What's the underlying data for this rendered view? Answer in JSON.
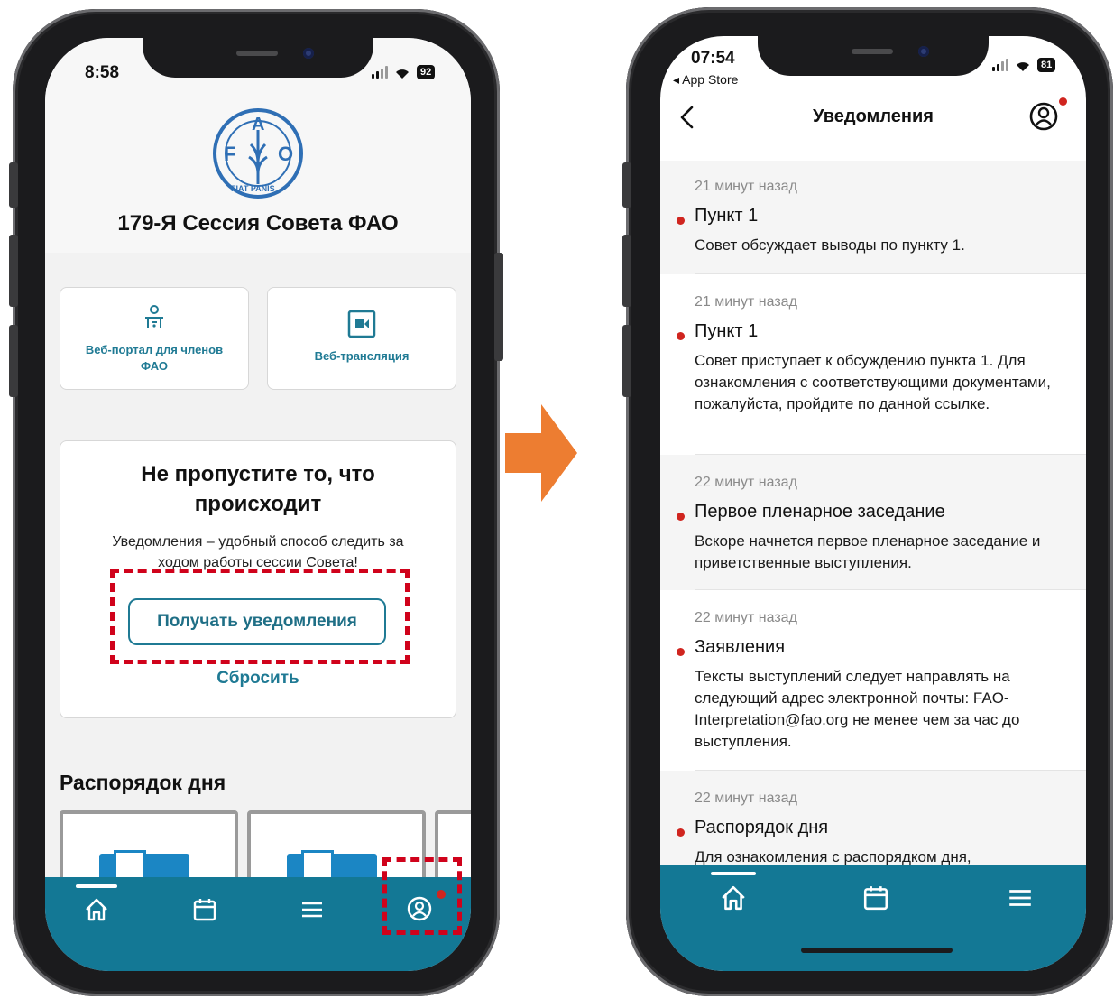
{
  "left": {
    "status_time": "8:58",
    "battery": "92",
    "app_title": "179-Я Сессия Совета ФАО",
    "logo": {
      "letters": [
        "F",
        "A",
        "O"
      ],
      "motto": "FIAT PANIS"
    },
    "quick_links": [
      {
        "label": "Веб-портал для членов ФАО",
        "icon": "person-desk-icon"
      },
      {
        "label": "Веб-трансляция",
        "icon": "video-camera-icon"
      }
    ],
    "promo": {
      "heading": "Не пропустите то, что происходит",
      "text": "Уведомления – удобный способ следить за ходом работы сессии Совета!",
      "subscribe_button": "Получать уведомления",
      "reset_link": "Сбросить"
    },
    "schedule_heading": "Распорядок дня",
    "tabs": [
      "home-icon",
      "calendar-icon",
      "menu-icon",
      "profile-icon"
    ]
  },
  "right": {
    "status_time": "07:54",
    "back_to_app": "◂ App Store",
    "battery": "81",
    "header_title": "Уведомления",
    "notifications": [
      {
        "time": "21 минут назад",
        "title": "Пункт 1",
        "text": "Совет обсуждает выводы по пункту 1."
      },
      {
        "time": "21 минут назад",
        "title": "Пункт 1",
        "text": "Совет приступает к обсуждению пункта 1. Для ознакомления с соответствующими документами, пожалуйста, пройдите по данной ссылке."
      },
      {
        "time": "22 минут назад",
        "title": "Первое пленарное заседание",
        "text": "Вскоре начнется первое пленарное заседание и приветственные выступления."
      },
      {
        "time": "22 минут назад",
        "title": "Заявления",
        "text": "Тексты выступлений следует направлять на следующий адрес электронной почты: FAO-Interpretation@fao.org не менее чем за час до выступления."
      },
      {
        "time": "22 минут назад",
        "title": "Распорядок дня",
        "text": "Для ознакомления с распорядком дня,"
      }
    ],
    "tabs": [
      "home-icon",
      "calendar-icon",
      "menu-icon"
    ]
  },
  "colors": {
    "teal": "#137895",
    "button_border": "#1f7a94",
    "highlight": "#d0021b",
    "arrow": "#ed7d31",
    "unread_dot": "#d0251f"
  }
}
